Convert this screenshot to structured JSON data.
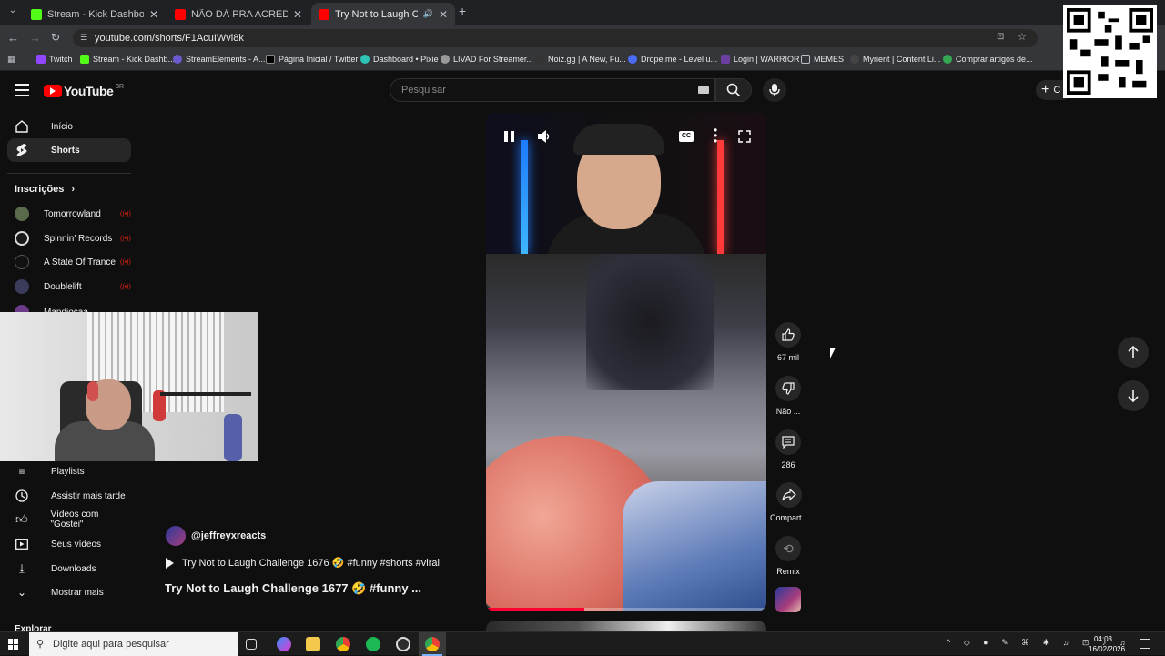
{
  "tabs": [
    {
      "title": "Stream - Kick Dashboard",
      "color": "#53fc18"
    },
    {
      "title": "NÃO DÁ PRA ACREDITAR NO C",
      "color": "#ff0000"
    },
    {
      "title": "Try Not to Laugh Challenge",
      "color": "#ff0000"
    }
  ],
  "address": "youtube.com/shorts/F1AcuIWvi8k",
  "bookmarks": [
    "Twitch",
    "Stream - Kick Dashb...",
    "StreamElements - A...",
    "Página Inicial / Twitter",
    "Dashboard • Pixie",
    "LIVAD For Streamer...",
    "Noiz.gg | A New, Fu...",
    "Drope.me - Level u...",
    "Login | WARRIOR",
    "MEMES",
    "Myrient | Content Li...",
    "Comprar artigos de..."
  ],
  "youtube": {
    "logo_text": "YouTube",
    "region": "BR",
    "search_placeholder": "Pesquisar",
    "create_label": "C"
  },
  "sidebar": {
    "home": "Início",
    "shorts": "Shorts",
    "subs_header": "Inscrições",
    "subscriptions": [
      "Tomorrowland",
      "Spinnin' Records",
      "A State Of Trance",
      "Doublelift",
      "Mandiocaa"
    ],
    "you_items": [
      "Playlists",
      "Assistir mais tarde",
      "Vídeos com \"Gostei\"",
      "Seus vídeos",
      "Downloads",
      "Mostrar mais"
    ],
    "explore": "Explorar"
  },
  "video": {
    "channel": "@jeffreyxreacts",
    "related": "Try Not to Laugh Challenge 1676 🤣 #funny #shorts #viral",
    "title": "Try Not to Laugh Challenge 1677 🤣 #funny ...",
    "progress": 0.35
  },
  "actions": {
    "likes": "67 mil",
    "dislike": "Não ...",
    "comments": "286",
    "share": "Compart...",
    "remix": "Remix"
  },
  "taskbar": {
    "search_placeholder": "Digite aqui para pesquisar",
    "time": "04:03",
    "date": "16/02/2026"
  }
}
